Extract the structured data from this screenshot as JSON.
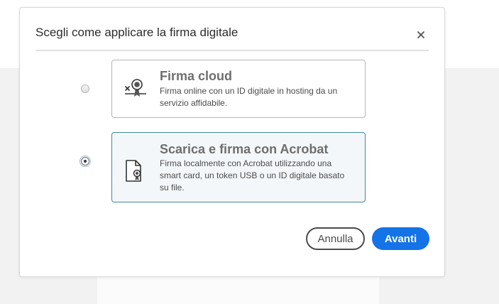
{
  "dialog": {
    "title": "Scegli come applicare la firma digitale",
    "close_icon": "close-icon"
  },
  "options": [
    {
      "title": "Firma cloud",
      "description": "Firma online con un ID digitale in hosting da un servizio affidabile.",
      "icon": "cloud-signature-icon",
      "selected": false
    },
    {
      "title": "Scarica e firma con Acrobat",
      "description": "Firma localmente con Acrobat utilizzando una smart card, un token USB o un ID digitale basato su file.",
      "icon": "certificate-file-icon",
      "selected": true
    }
  ],
  "buttons": {
    "cancel_label": "Annulla",
    "next_label": "Avanti"
  },
  "colors": {
    "accent": "#1473e6",
    "selected_border": "#3f8a9d",
    "selected_bg": "#f4f7f9"
  }
}
